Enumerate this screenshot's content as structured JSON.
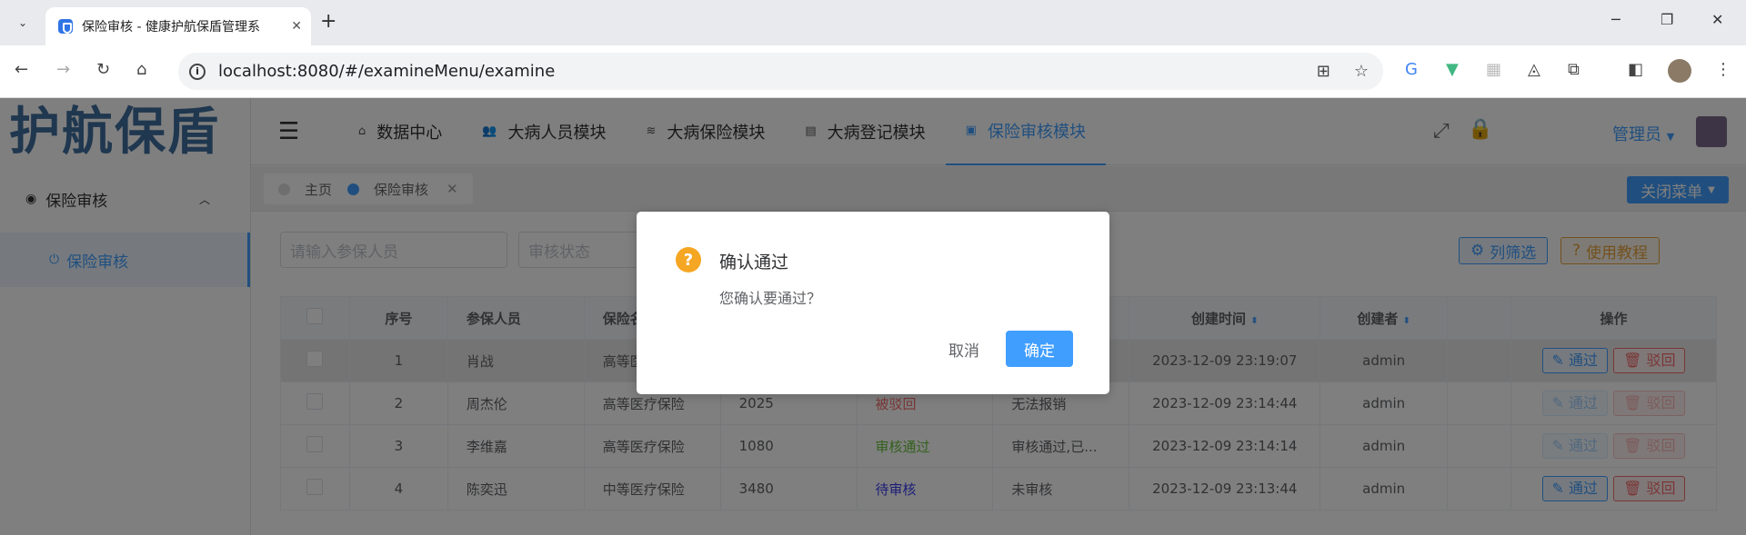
{
  "browser": {
    "tab_title": "保险审核 - 健康护航保盾管理系",
    "url": "localhost:8080/#/examineMenu/examine"
  },
  "sidebar": {
    "logo": "护航保盾",
    "group_label": "保险审核",
    "item_label": "保险审核"
  },
  "topnav": {
    "items": [
      {
        "label": "数据中心"
      },
      {
        "label": "大病人员模块"
      },
      {
        "label": "大病保险模块"
      },
      {
        "label": "大病登记模块"
      },
      {
        "label": "保险审核模块"
      }
    ],
    "user": "管理员"
  },
  "tags": {
    "home": "主页",
    "current": "保险审核",
    "close_menu": "关闭菜单"
  },
  "filters": {
    "insured_placeholder": "请输入参保人员",
    "status_placeholder": "审核状态",
    "column_filter": "列筛选",
    "tutorial": "使用教程"
  },
  "table": {
    "headers": [
      "序号",
      "参保人员",
      "保险名",
      "",
      "",
      "",
      "创建时间",
      "创建者",
      "",
      "操作"
    ],
    "rows": [
      {
        "no": "1",
        "name": "肖战",
        "insurance": "高等医",
        "amount": "",
        "status": "",
        "remark": "",
        "time": "2023-12-09 23:19:07",
        "creator": "admin"
      },
      {
        "no": "2",
        "name": "周杰伦",
        "insurance": "高等医疗保险",
        "amount": "2025",
        "status": "被驳回",
        "remark": "无法报销",
        "time": "2023-12-09 23:14:44",
        "creator": "admin"
      },
      {
        "no": "3",
        "name": "李维嘉",
        "insurance": "高等医疗保险",
        "amount": "1080",
        "status": "审核通过",
        "remark": "审核通过,已...",
        "time": "2023-12-09 23:14:14",
        "creator": "admin"
      },
      {
        "no": "4",
        "name": "陈奕迅",
        "insurance": "中等医疗保险",
        "amount": "3480",
        "status": "待审核",
        "remark": "未审核",
        "time": "2023-12-09 23:13:44",
        "creator": "admin"
      }
    ],
    "pass_label": "通过",
    "reject_label": "驳回"
  },
  "dialog": {
    "title": "确认通过",
    "message": "您确认要通过？",
    "cancel": "取消",
    "confirm": "确定"
  },
  "colors": {
    "primary": "#409eff",
    "danger": "#f56c6c",
    "success": "#67c23a",
    "warning_icon": "#f5a623"
  }
}
